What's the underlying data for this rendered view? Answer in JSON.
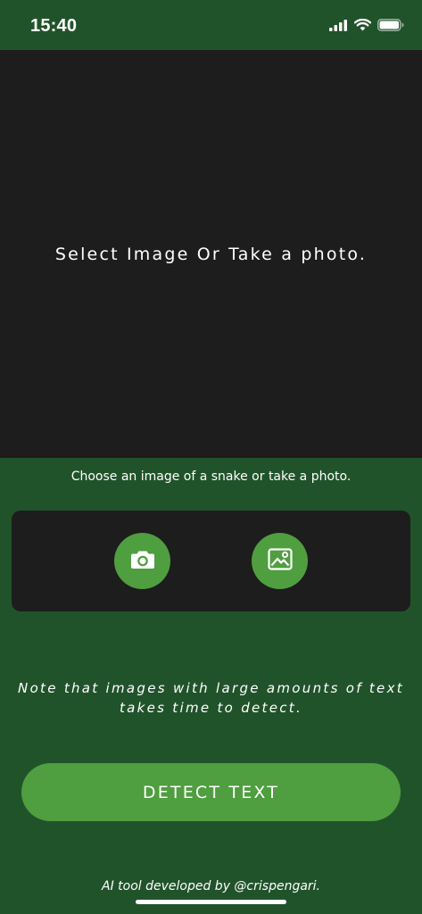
{
  "status_bar": {
    "time": "15:40",
    "icons": [
      "signal-icon",
      "wifi-icon",
      "battery-icon"
    ]
  },
  "preview": {
    "placeholder": "Select Image Or Take a photo."
  },
  "picker": {
    "hint": "Choose an image of a snake or take a photo.",
    "camera_icon": "camera-icon",
    "gallery_icon": "gallery-icon"
  },
  "note": {
    "line1": "Note that images with large amounts of text",
    "line2": "takes time to detect."
  },
  "detect_button": {
    "label": "DETECT TEXT"
  },
  "footer": {
    "text": "AI tool developed by @crispengari."
  },
  "colors": {
    "background": "#21532b",
    "panel": "#1d1d1d",
    "accent": "#4f9e3f"
  }
}
